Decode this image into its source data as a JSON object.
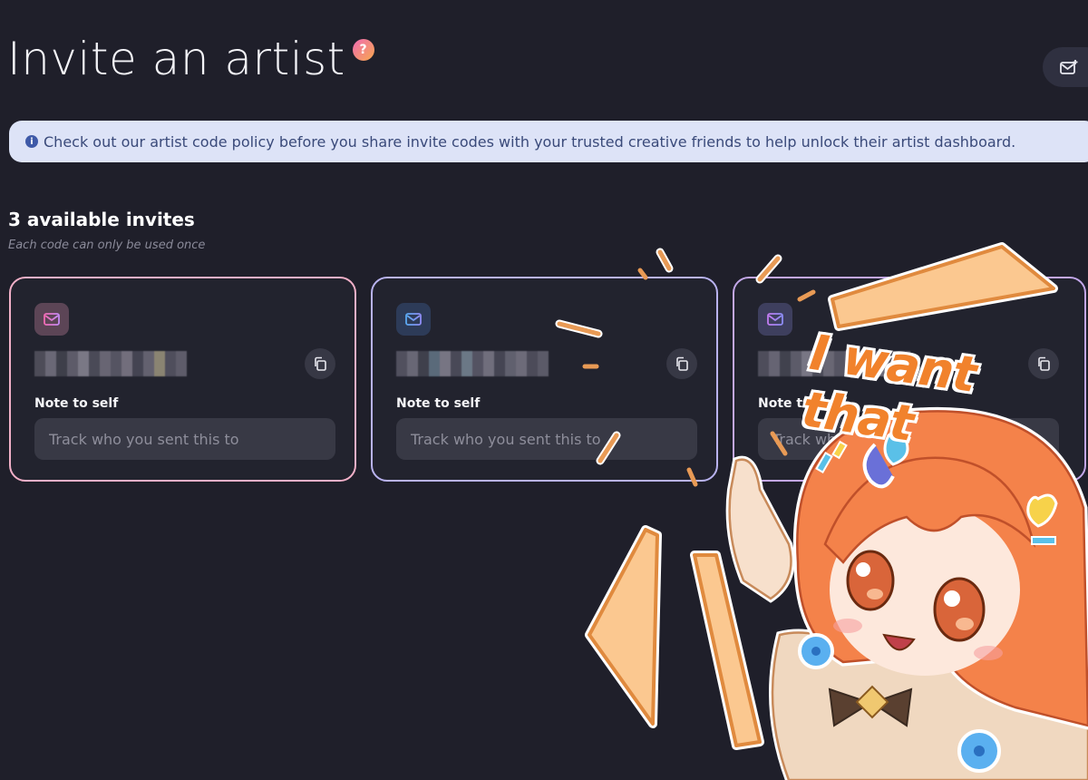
{
  "page": {
    "title": "Invite an artist",
    "help_glyph": "?"
  },
  "banner": {
    "info_glyph": "i",
    "text": "Check out our artist code policy before you share invite codes with your trusted creative friends to help unlock their artist dashboard."
  },
  "invites": {
    "count_label": "3 available invites",
    "subtitle": "Each code can only be used once",
    "cards": [
      {
        "code_hidden": true,
        "icon": "mail-icon",
        "copy_icon": "copy-icon",
        "note_label": "Note to self",
        "note_placeholder": "Track who you sent this to"
      },
      {
        "code_hidden": true,
        "icon": "mail-icon",
        "copy_icon": "copy-icon",
        "note_label": "Note to self",
        "note_placeholder": "Track who you sent this to"
      },
      {
        "code_hidden": true,
        "icon": "mail-icon",
        "copy_icon": "copy-icon",
        "note_label": "Note to self",
        "note_placeholder": "Track who you sent this to"
      }
    ]
  },
  "sticker": {
    "text": "I want that"
  },
  "colors": {
    "background": "#1f1f2a",
    "banner_bg": "#dde3f7",
    "card1_border": "#f2b0c8",
    "card2_border": "#b9b3f0",
    "card3_border": "#c3a7e9",
    "sticker_orange": "#f1822c"
  }
}
